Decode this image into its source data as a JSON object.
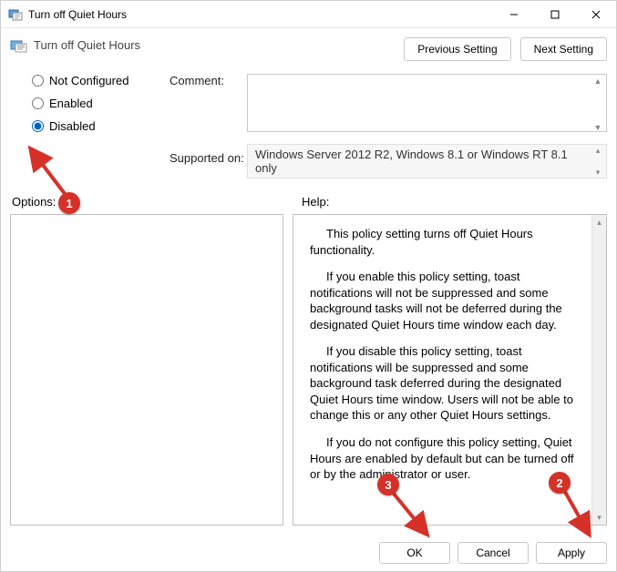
{
  "window": {
    "title": "Turn off Quiet Hours"
  },
  "header": {
    "subtitle": "Turn off Quiet Hours",
    "prev_label": "Previous Setting",
    "next_label": "Next Setting"
  },
  "radios": {
    "not_configured": "Not Configured",
    "enabled": "Enabled",
    "disabled": "Disabled",
    "selected": "disabled"
  },
  "labels": {
    "comment": "Comment:",
    "supported_on": "Supported on:",
    "options": "Options:",
    "help": "Help:"
  },
  "fields": {
    "comment_value": "",
    "supported_on_value": "Windows Server 2012 R2, Windows 8.1 or Windows RT 8.1 only"
  },
  "help": {
    "p1": "This policy setting turns off Quiet Hours functionality.",
    "p2": "If you enable this policy setting, toast notifications will not be suppressed and some background tasks will not be deferred during the designated Quiet Hours time window each day.",
    "p3": "If you disable this policy setting, toast notifications will be suppressed and some background task deferred during the designated Quiet Hours time window.  Users will not be able to change this or any other Quiet Hours settings.",
    "p4": "If you do not configure this policy setting, Quiet Hours are enabled by default but can be turned off or by the administrator or user."
  },
  "footer": {
    "ok": "OK",
    "cancel": "Cancel",
    "apply": "Apply"
  },
  "annotations": {
    "step1": "1",
    "step2": "2",
    "step3": "3"
  }
}
